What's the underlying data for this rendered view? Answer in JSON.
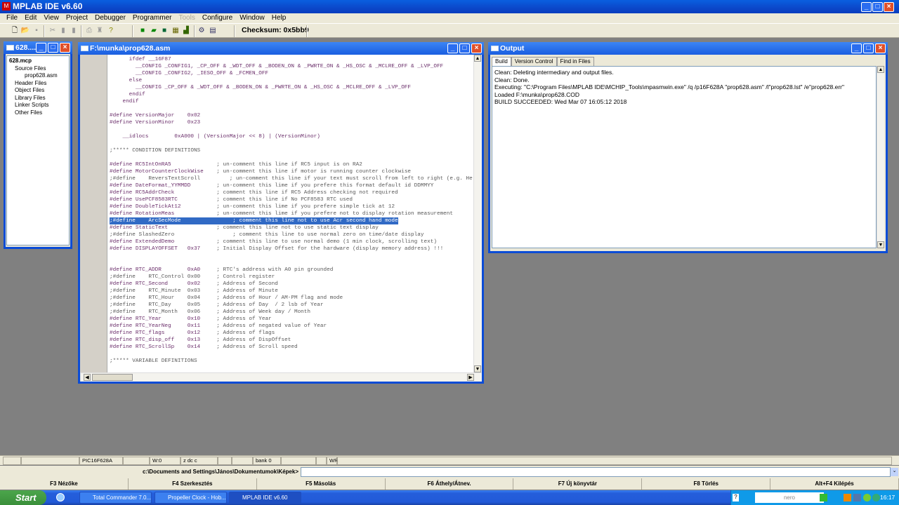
{
  "app": {
    "title": "MPLAB IDE v6.60"
  },
  "menu": [
    {
      "label": "File"
    },
    {
      "label": "Edit"
    },
    {
      "label": "View"
    },
    {
      "label": "Project"
    },
    {
      "label": "Debugger"
    },
    {
      "label": "Programmer"
    },
    {
      "label": "Tools",
      "disabled": true
    },
    {
      "label": "Configure"
    },
    {
      "label": "Window"
    },
    {
      "label": "Help"
    }
  ],
  "toolbar": {
    "checksum": "Checksum:  0x5bb9"
  },
  "project": {
    "title": "628....",
    "tree": [
      "628.mcp",
      "Source Files",
      "prop628.asm",
      "Header Files",
      "Object Files",
      "Library Files",
      "Linker Scripts",
      "Other Files"
    ]
  },
  "editor": {
    "title": "F:\\munka\\prop628.asm",
    "highlight_line": 23,
    "lines": [
      "      ifdef __16F87",
      "        __CONFIG _CONFIG1, _CP_OFF & _WDT_OFF & _BODEN_ON & _PWRTE_ON & _HS_OSC & _MCLRE_OFF & _LVP_OFF",
      "        __CONFIG _CONFIG2, _IESO_OFF & _FCMEN_OFF",
      "      else",
      "        __CONFIG _CP_OFF & _WDT_OFF & _BODEN_ON & _PWRTE_ON & _HS_OSC & _MCLRE_OFF & _LVP_OFF",
      "      endif",
      "    endif",
      "",
      "#define VersionMajor    0x02",
      "#define VersionMinor    0x23",
      "",
      "    __idlocs        0xA000 | (VersionMajor << 8) | (VersionMinor)",
      "",
      ";***** CONDITION DEFINITIONS",
      "",
      "#define RC5IntOnRA5              ; un-comment this line if RC5 input is on RA2",
      "#define MotorCounterClockWise    ; un-comment this line if motor is running counter clockwise",
      ";#define    ReversTextScroll         ; un-comment this line if your text must scroll from left to right (e.g. He",
      "#define DateFormat_YYMMDD        ; un-comment this lime if you prefere this format default id DDMMYY",
      "#define RC5AddrCheck             ; comment this line if RC5 Address checking not required",
      "#define UsePCF8583RTC            ; comment this line if No PCF8583 RTC used",
      "#define DoubleTickAt12           ; un-comment this lime if you prefere simple tick at 12",
      "#define RotationMeas             ; un-comment this lime if you prefere not to display rotation measurement",
      ";#define    ArcSecMode                ; comment this line not to use Acr second hand mode",
      "#define StaticText               ; comment this line not to use static text display",
      ";#define SlashedZero                  ; comment this line to use normal zero on time/date display",
      "#define ExtendedDemo             ; comment this line to use normal demo (1 min clock, scrolling text)",
      "#define DISPLAYOFFSET   0x37     ; Initial Display Offset for the hardware (display memory address) !!!",
      "",
      "",
      "#define RTC_ADDR        0xA0     ; RTC's address with A0 pin grounded",
      ";#define    RTC_Control 0x00     ; Control register",
      "#define RTC_Second      0x02     ; Address of Second",
      ";#define    RTC_Minute  0x03     ; Address of Minute",
      ";#define    RTC_Hour    0x04     ; Address of Hour / AM-PM flag and mode",
      ";#define    RTC_Day     0x05     ; Address of Day  / 2 lsb of Year",
      ";#define    RTC_Month   0x06     ; Address of Week day / Month",
      "#define RTC_Year        0x10     ; Address of Year",
      "#define RTC_YearNeg     0x11     ; Address of negated value of Year",
      "#define RTC_flags       0x12     ; Address of flags",
      "#define RTC_disp_off    0x13     ; Address of DispOffset",
      "#define RTC_ScrollSp    0x14     ; Address of Scroll speed",
      "",
      ";***** VARIABLE DEFINITIONS"
    ]
  },
  "output": {
    "title": "Output",
    "tabs": [
      "Build",
      "Version Control",
      "Find in Files"
    ],
    "lines": [
      "Clean: Deleting intermediary and output files.",
      "Clean: Done.",
      "Executing: \"C:\\Program Files\\MPLAB IDE\\MCHIP_Tools\\mpasmwin.exe\" /q /p16F628A \"prop628.asm\" /l\"prop628.lst\" /e\"prop628.err\"",
      "Loaded F:\\munka\\prop628.COD",
      "BUILD SUCCEEDED: Wed Mar 07 16:05:12 2018"
    ]
  },
  "statusbar": [
    "",
    "",
    "PIC16F628A",
    "",
    "W:0",
    "z dc c",
    "",
    "",
    "bank 0",
    "",
    "",
    "WR",
    ""
  ],
  "commandline": {
    "path": "c:\\Documents and Settings\\János\\Dokumentumok\\Képek>",
    "value": ""
  },
  "fkeys": [
    "F3 Nézőke",
    "F4 Szerkesztés",
    "F5 Másolás",
    "F6 Áthely/Átnev.",
    "F7 Új könyvtár",
    "F8 Törlés",
    "Alt+F4 Kilépés"
  ],
  "taskbar": {
    "start": "Start",
    "tasks": [
      "Total Commander 7.0...",
      "Propeller Clock - Hob...",
      "MPLAB IDE v6.60"
    ],
    "active_task": 2,
    "clock": "16:17",
    "nero": "nero"
  },
  "colors": {
    "titlebar": "#0b4cd6",
    "highlight": "#316ac5",
    "directive": "#6b2f6b",
    "comment": "#5a5a5a"
  }
}
